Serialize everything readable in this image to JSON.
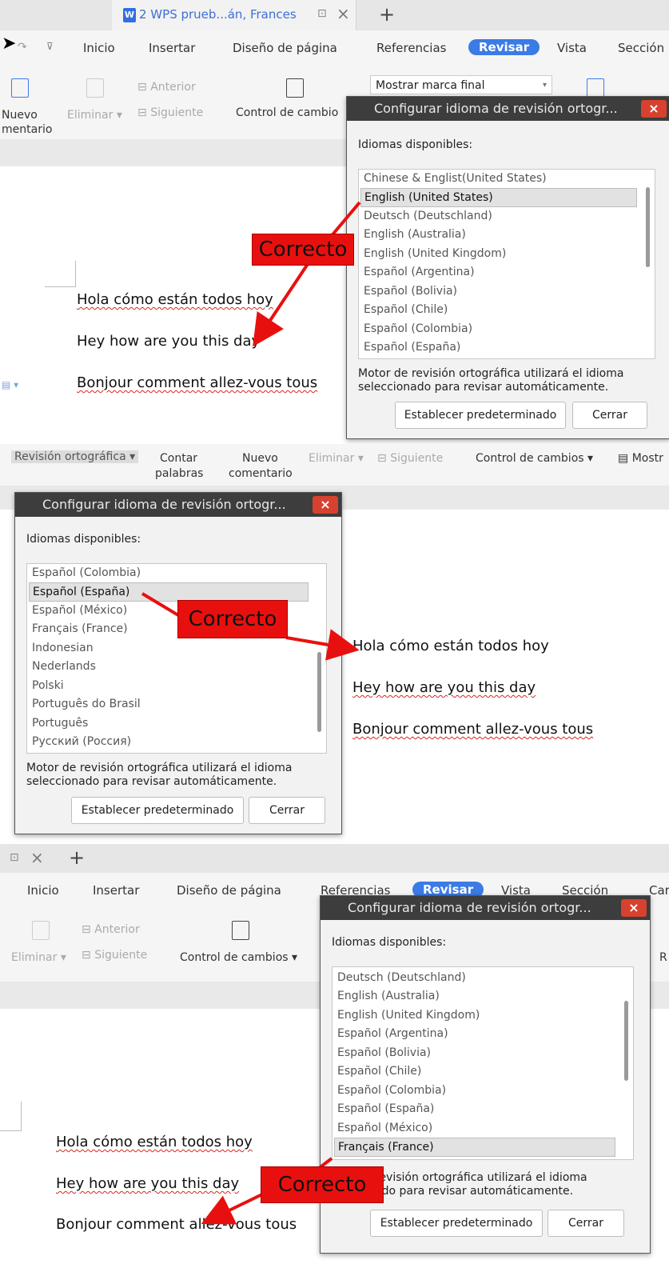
{
  "window": {
    "tab_title": "2 WPS prueb...án, Frances",
    "tab_close": "×",
    "new_tab": "+"
  },
  "menus": {
    "inicio": "Inicio",
    "insertar": "Insertar",
    "diseno": "Diseño de página",
    "referencias": "Referencias",
    "revisar": "Revisar",
    "vista": "Vista",
    "seccion": "Sección",
    "ca": "Car"
  },
  "ribbon": {
    "nuevo_comentario_l1": "Nuevo",
    "nuevo_comentario_l2": "comentario",
    "nuevo_comentario_trunc": "mentario",
    "eliminar": "Eliminar",
    "anterior": "Anterior",
    "siguiente": "Siguiente",
    "control_cambios": "Control de cambios",
    "control_cambios_trunc": "Control de cambio",
    "mostrar_marca": "Mostrar marca final",
    "revision_ortografica": "Revisión ortográfica",
    "contar_l1": "Contar",
    "contar_l2": "palabras",
    "mostrar": "Mostr",
    "r": "R"
  },
  "dialog": {
    "title": "Configurar idioma de revisión ortogr...",
    "close": "×",
    "label": "Idiomas disponibles:",
    "motor_text": "Motor de revisión ortográfica utilizará el idioma seleccionado para revisar automáticamente.",
    "motor_text_partial_1": "revisión ortográfica utilizará el idioma",
    "motor_text_partial_2": "ado para revisar automáticamente.",
    "btn_default": "Establecer predeterminado",
    "btn_close": "Cerrar"
  },
  "lists": {
    "panel1": [
      "Chinese & Englist(United States)",
      "English (United States)",
      "Deutsch (Deutschland)",
      "English (Australia)",
      "English (United Kingdom)",
      "Español (Argentina)",
      "Español (Bolivia)",
      "Español (Chile)",
      "Español (Colombia)",
      "Español (España)"
    ],
    "panel2": [
      "Español (Colombia)",
      "Español (España)",
      "Español (México)",
      "Français (France)",
      "Indonesian",
      "Nederlands",
      "Polski",
      "Português do Brasil",
      "Português",
      "Русский (Россия)"
    ],
    "panel3": [
      "Deutsch (Deutschland)",
      "English (Australia)",
      "English (United Kingdom)",
      "Español (Argentina)",
      "Español (Bolivia)",
      "Español (Chile)",
      "Español (Colombia)",
      "Español (España)",
      "Español (México)",
      "Français (France)"
    ]
  },
  "document": {
    "line1": "Hola cómo están todos hoy",
    "line2": "Hey how are you this day",
    "line3": "Bonjour comment allez-vous tous"
  },
  "callout": {
    "text": "Correcto"
  }
}
